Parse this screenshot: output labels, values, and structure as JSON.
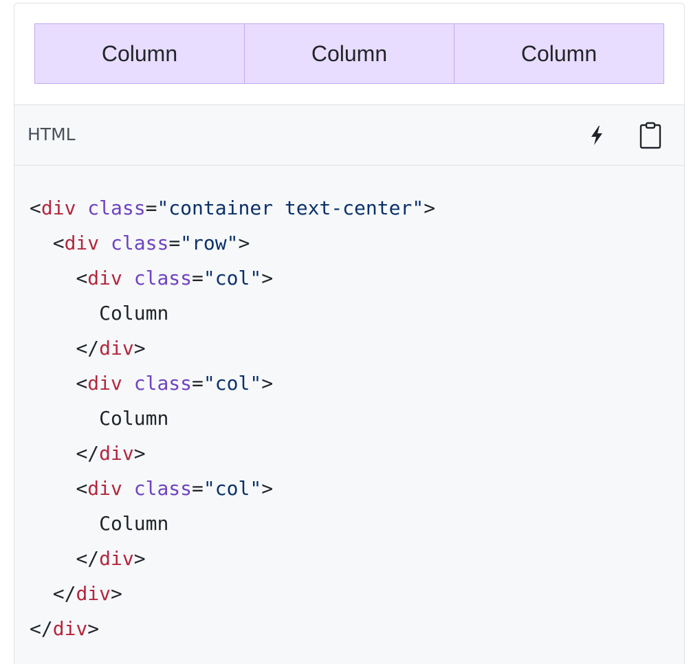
{
  "preview": {
    "columns": [
      "Column",
      "Column",
      "Column"
    ],
    "background_color": "#e8dcff",
    "border_color": "#c0a8f0"
  },
  "code_block": {
    "language": "HTML",
    "actions": {
      "run_icon": "lightning-bolt-icon",
      "copy_icon": "clipboard-icon"
    },
    "lines": [
      {
        "indent": "",
        "open": "<",
        "tag": "div",
        "attr": "class",
        "value": "\"container text-center\"",
        "close": ">"
      },
      {
        "indent": "  ",
        "open": "<",
        "tag": "div",
        "attr": "class",
        "value": "\"row\"",
        "close": ">"
      },
      {
        "indent": "    ",
        "open": "<",
        "tag": "div",
        "attr": "class",
        "value": "\"col\"",
        "close": ">"
      },
      {
        "indent": "      ",
        "text": "Column"
      },
      {
        "indent": "    ",
        "open": "</",
        "tag": "div",
        "close": ">"
      },
      {
        "indent": "    ",
        "open": "<",
        "tag": "div",
        "attr": "class",
        "value": "\"col\"",
        "close": ">"
      },
      {
        "indent": "      ",
        "text": "Column"
      },
      {
        "indent": "    ",
        "open": "</",
        "tag": "div",
        "close": ">"
      },
      {
        "indent": "    ",
        "open": "<",
        "tag": "div",
        "attr": "class",
        "value": "\"col\"",
        "close": ">"
      },
      {
        "indent": "      ",
        "text": "Column"
      },
      {
        "indent": "    ",
        "open": "</",
        "tag": "div",
        "close": ">"
      },
      {
        "indent": "  ",
        "open": "</",
        "tag": "div",
        "close": ">"
      },
      {
        "indent": "",
        "open": "</",
        "tag": "div",
        "close": ">"
      }
    ],
    "colors": {
      "tag": "#b3263c",
      "attribute": "#6f42c1",
      "string": "#0a3069",
      "background": "#f6f8fa"
    }
  }
}
